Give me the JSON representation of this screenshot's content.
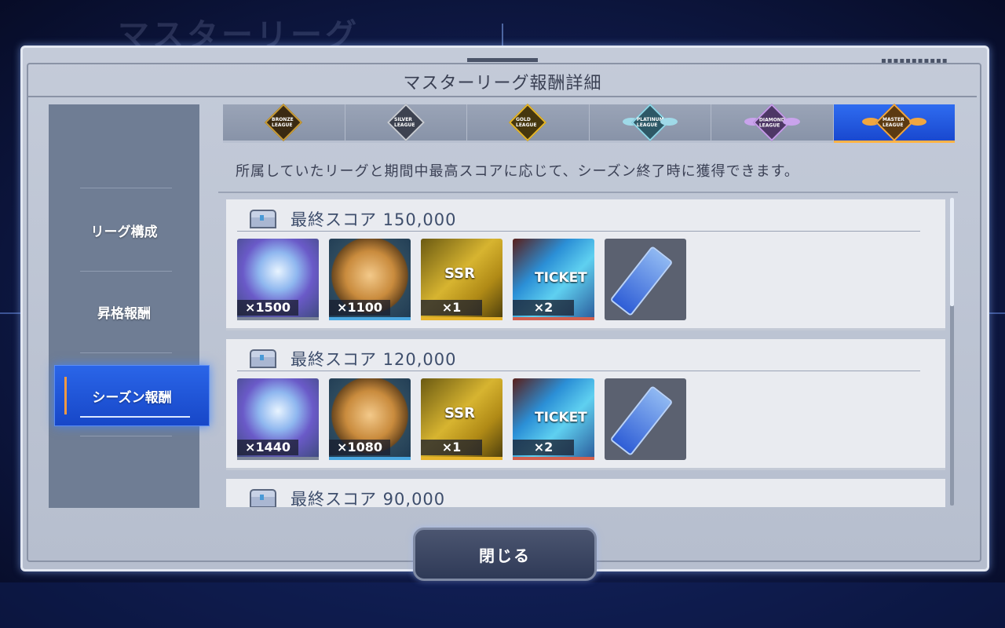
{
  "background": {
    "blur_title": "マスターリーグ"
  },
  "dialog": {
    "title": "マスターリーグ報酬詳細",
    "description": "所属していたリーグと期間中最高スコアに応じて、シーズン終了時に獲得できます。",
    "close_label": "閉じる"
  },
  "sidebar": {
    "items": [
      {
        "label": "リーグ構成",
        "active": false
      },
      {
        "label": "昇格報酬",
        "active": false
      },
      {
        "label": "シーズン報酬",
        "active": true
      }
    ]
  },
  "league_tabs": [
    {
      "name": "bronze-league",
      "label": "BRONZE LEAGUE",
      "color": "#c79a34",
      "active": false
    },
    {
      "name": "silver-league",
      "label": "SILVER LEAGUE",
      "color": "#c7cbd2",
      "active": false
    },
    {
      "name": "gold-league",
      "label": "GOLD LEAGUE",
      "color": "#e5b62a",
      "active": false
    },
    {
      "name": "platinum-league",
      "label": "PLATINUM LEAGUE",
      "color": "#8fd5e6",
      "active": false
    },
    {
      "name": "diamond-league",
      "label": "DIAMOND LEAGUE",
      "color": "#c49be8",
      "active": false
    },
    {
      "name": "master-league",
      "label": "MASTER LEAGUE",
      "color": "#f0a640",
      "active": true
    }
  ],
  "reward_groups": [
    {
      "title": "最終スコア 150,000",
      "items": [
        {
          "icon": "diamond-gem-icon",
          "quantity": "×1500",
          "rim": "grey"
        },
        {
          "icon": "master-league-medal-icon",
          "quantity": "×1100",
          "rim": "blue"
        },
        {
          "icon": "ssr-ticket-icon",
          "quantity": "×1",
          "rim": "gold",
          "ticket_text": "SSR"
        },
        {
          "icon": "ticket-icon",
          "quantity": "×2",
          "rim": "red",
          "ticket_text": "TICKET"
        },
        {
          "icon": "blue-card-icon",
          "quantity": "",
          "rim": "none"
        }
      ]
    },
    {
      "title": "最終スコア 120,000",
      "items": [
        {
          "icon": "diamond-gem-icon",
          "quantity": "×1440",
          "rim": "grey"
        },
        {
          "icon": "master-league-medal-icon",
          "quantity": "×1080",
          "rim": "blue"
        },
        {
          "icon": "ssr-ticket-icon",
          "quantity": "×1",
          "rim": "gold",
          "ticket_text": "SSR"
        },
        {
          "icon": "ticket-icon",
          "quantity": "×2",
          "rim": "red",
          "ticket_text": "TICKET"
        },
        {
          "icon": "blue-card-icon",
          "quantity": "",
          "rim": "none"
        }
      ]
    },
    {
      "title": "最終スコア 90,000",
      "items": []
    }
  ]
}
